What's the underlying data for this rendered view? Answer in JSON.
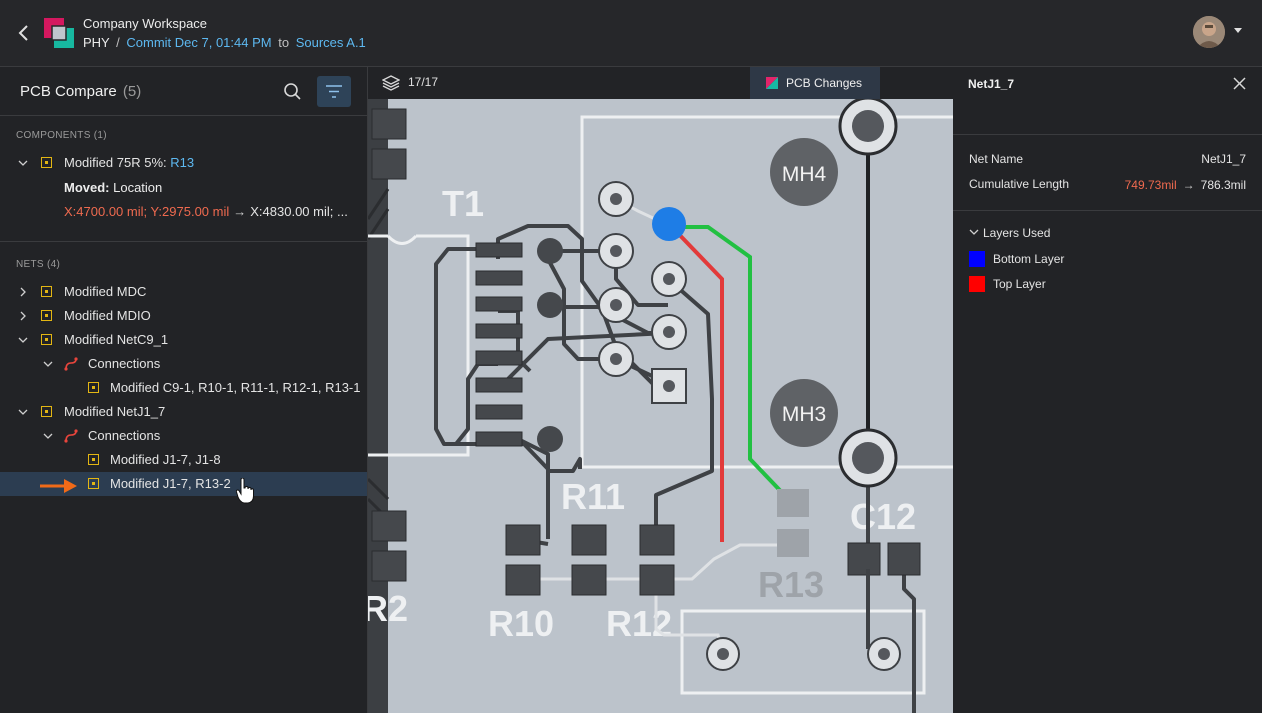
{
  "header": {
    "workspace": "Company Workspace",
    "project": "PHY",
    "separator": "/",
    "commit": "Commit Dec 7, 01:44 PM",
    "to_word": "to",
    "target": "Sources A.1"
  },
  "left_panel": {
    "title": "PCB Compare",
    "count": "(5)",
    "components_label": "COMPONENTS (1)",
    "component": {
      "prefix": "Modified 75R 5%: ",
      "ref": "R13",
      "moved_label": "Moved:",
      "moved_value": " Location",
      "old_location": "X:4700.00 mil; Y:2975.00 mil",
      "arrow": "→",
      "new_location": "X:4830.00 mil; ..."
    },
    "nets_label": "NETS (4)",
    "nets": [
      {
        "label": "Modified MDC"
      },
      {
        "label": "Modified MDIO"
      },
      {
        "label": "Modified NetC9_1"
      },
      {
        "label": "Connections"
      },
      {
        "label": "Modified C9-1, R10-1, R11-1, R12-1, R13-1"
      },
      {
        "label": "Modified NetJ1_7"
      },
      {
        "label": "Connections"
      },
      {
        "label": "Modified J1-7, J1-8"
      },
      {
        "label": "Modified J1-7, R13-2"
      }
    ]
  },
  "center": {
    "layer_count": "17/17",
    "tab_label": "PCB Changes"
  },
  "pcb_labels": {
    "t1": "T1",
    "mh4": "MH4",
    "mh3": "MH3",
    "r11": "R11",
    "r10": "R10",
    "r12": "R12",
    "r13": "R13",
    "c12": "C12",
    "r2": "R2"
  },
  "right_panel": {
    "title": "NetJ1_7",
    "net_name_label": "Net Name",
    "net_name_value": "NetJ1_7",
    "length_label": "Cumulative Length",
    "length_old": "749.73mil",
    "length_arrow": "→",
    "length_new": "786.3mil",
    "layers_used_label": "Layers Used",
    "layers": [
      {
        "label": "Bottom Layer",
        "color": "#0000ff"
      },
      {
        "label": "Top Layer",
        "color": "#ff0000"
      }
    ]
  },
  "colors": {
    "accent_link": "#5db8f0",
    "changed_old": "#ef6a4f",
    "modified_icon": "#e3b613",
    "selection": "#2c3d51",
    "trace_green": "#22c042",
    "trace_red": "#e23a3a",
    "via_blue": "#1e7de6"
  }
}
